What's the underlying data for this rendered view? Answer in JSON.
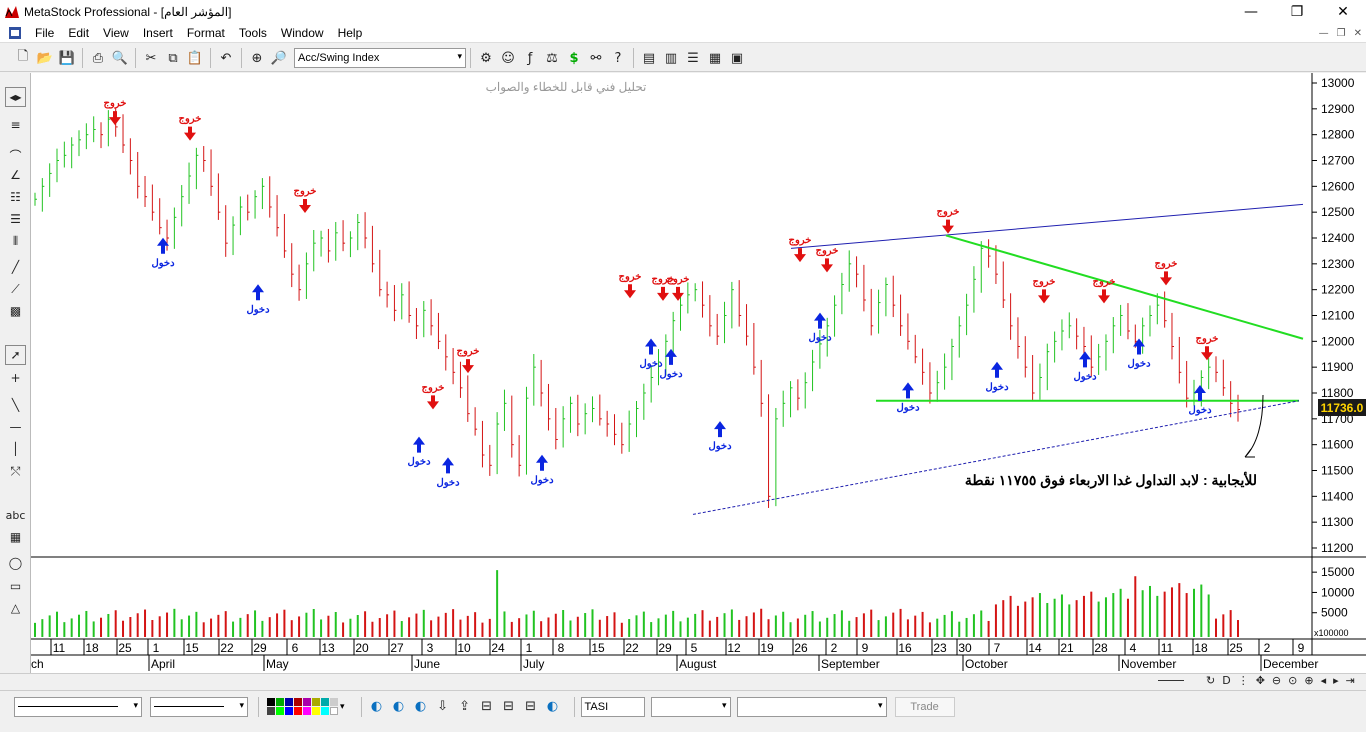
{
  "window": {
    "title": "MetaStock Professional - [المؤشر العام]"
  },
  "menu": [
    "File",
    "Edit",
    "View",
    "Insert",
    "Format",
    "Tools",
    "Window",
    "Help"
  ],
  "toolbar": {
    "indicator_combo": "Acc/Swing Index"
  },
  "chart": {
    "watermark": "تحليل فني قابل للخطاء والصواب",
    "annotation": "للأيجابية : لابد التداول غدا الاربعاء فوق ١١٧٥٥ نقطة",
    "last_price": "11736.0",
    "volume_scale": "x100000",
    "exit_label": "خروج",
    "entry_label": "دخول",
    "colors": {
      "up": "#22c322",
      "down": "#d41414",
      "trend_blue": "#2020b0",
      "trend_green": "#22dd22",
      "arrow_up": "#0a25e0",
      "arrow_down": "#e01010"
    }
  },
  "chart_data": {
    "type": "bar",
    "title": "",
    "price_axis": {
      "min": 11200,
      "max": 13000,
      "ticks": [
        11200,
        11300,
        11400,
        11500,
        11600,
        11700,
        11800,
        11900,
        12000,
        12100,
        12200,
        12300,
        12400,
        12500,
        12600,
        12700,
        12800,
        12900,
        13000
      ]
    },
    "volume_axis": {
      "ticks_labels": [
        "5000",
        "10000",
        "15000"
      ],
      "ticks": [
        5000,
        10000,
        15000
      ]
    },
    "date_ticks": [
      "11",
      "18",
      "25",
      "1",
      "15",
      "22",
      "29",
      "6",
      "13",
      "20",
      "27",
      "3",
      "10",
      "24",
      "1",
      "8",
      "15",
      "22",
      "29",
      "5",
      "12",
      "19",
      "26",
      "2",
      "9",
      "16",
      "23",
      "30",
      "7",
      "14",
      "21",
      "28",
      "4",
      "11",
      "18",
      "25",
      "2",
      "9"
    ],
    "month_labels": [
      "ch",
      "April",
      "May",
      "June",
      "July",
      "August",
      "September",
      "October",
      "November",
      "December"
    ],
    "last_value": 11736.0
  },
  "statusbar": {
    "zoom": "—"
  },
  "bottom": {
    "symbol": "TASI",
    "trade_label": "Trade"
  }
}
